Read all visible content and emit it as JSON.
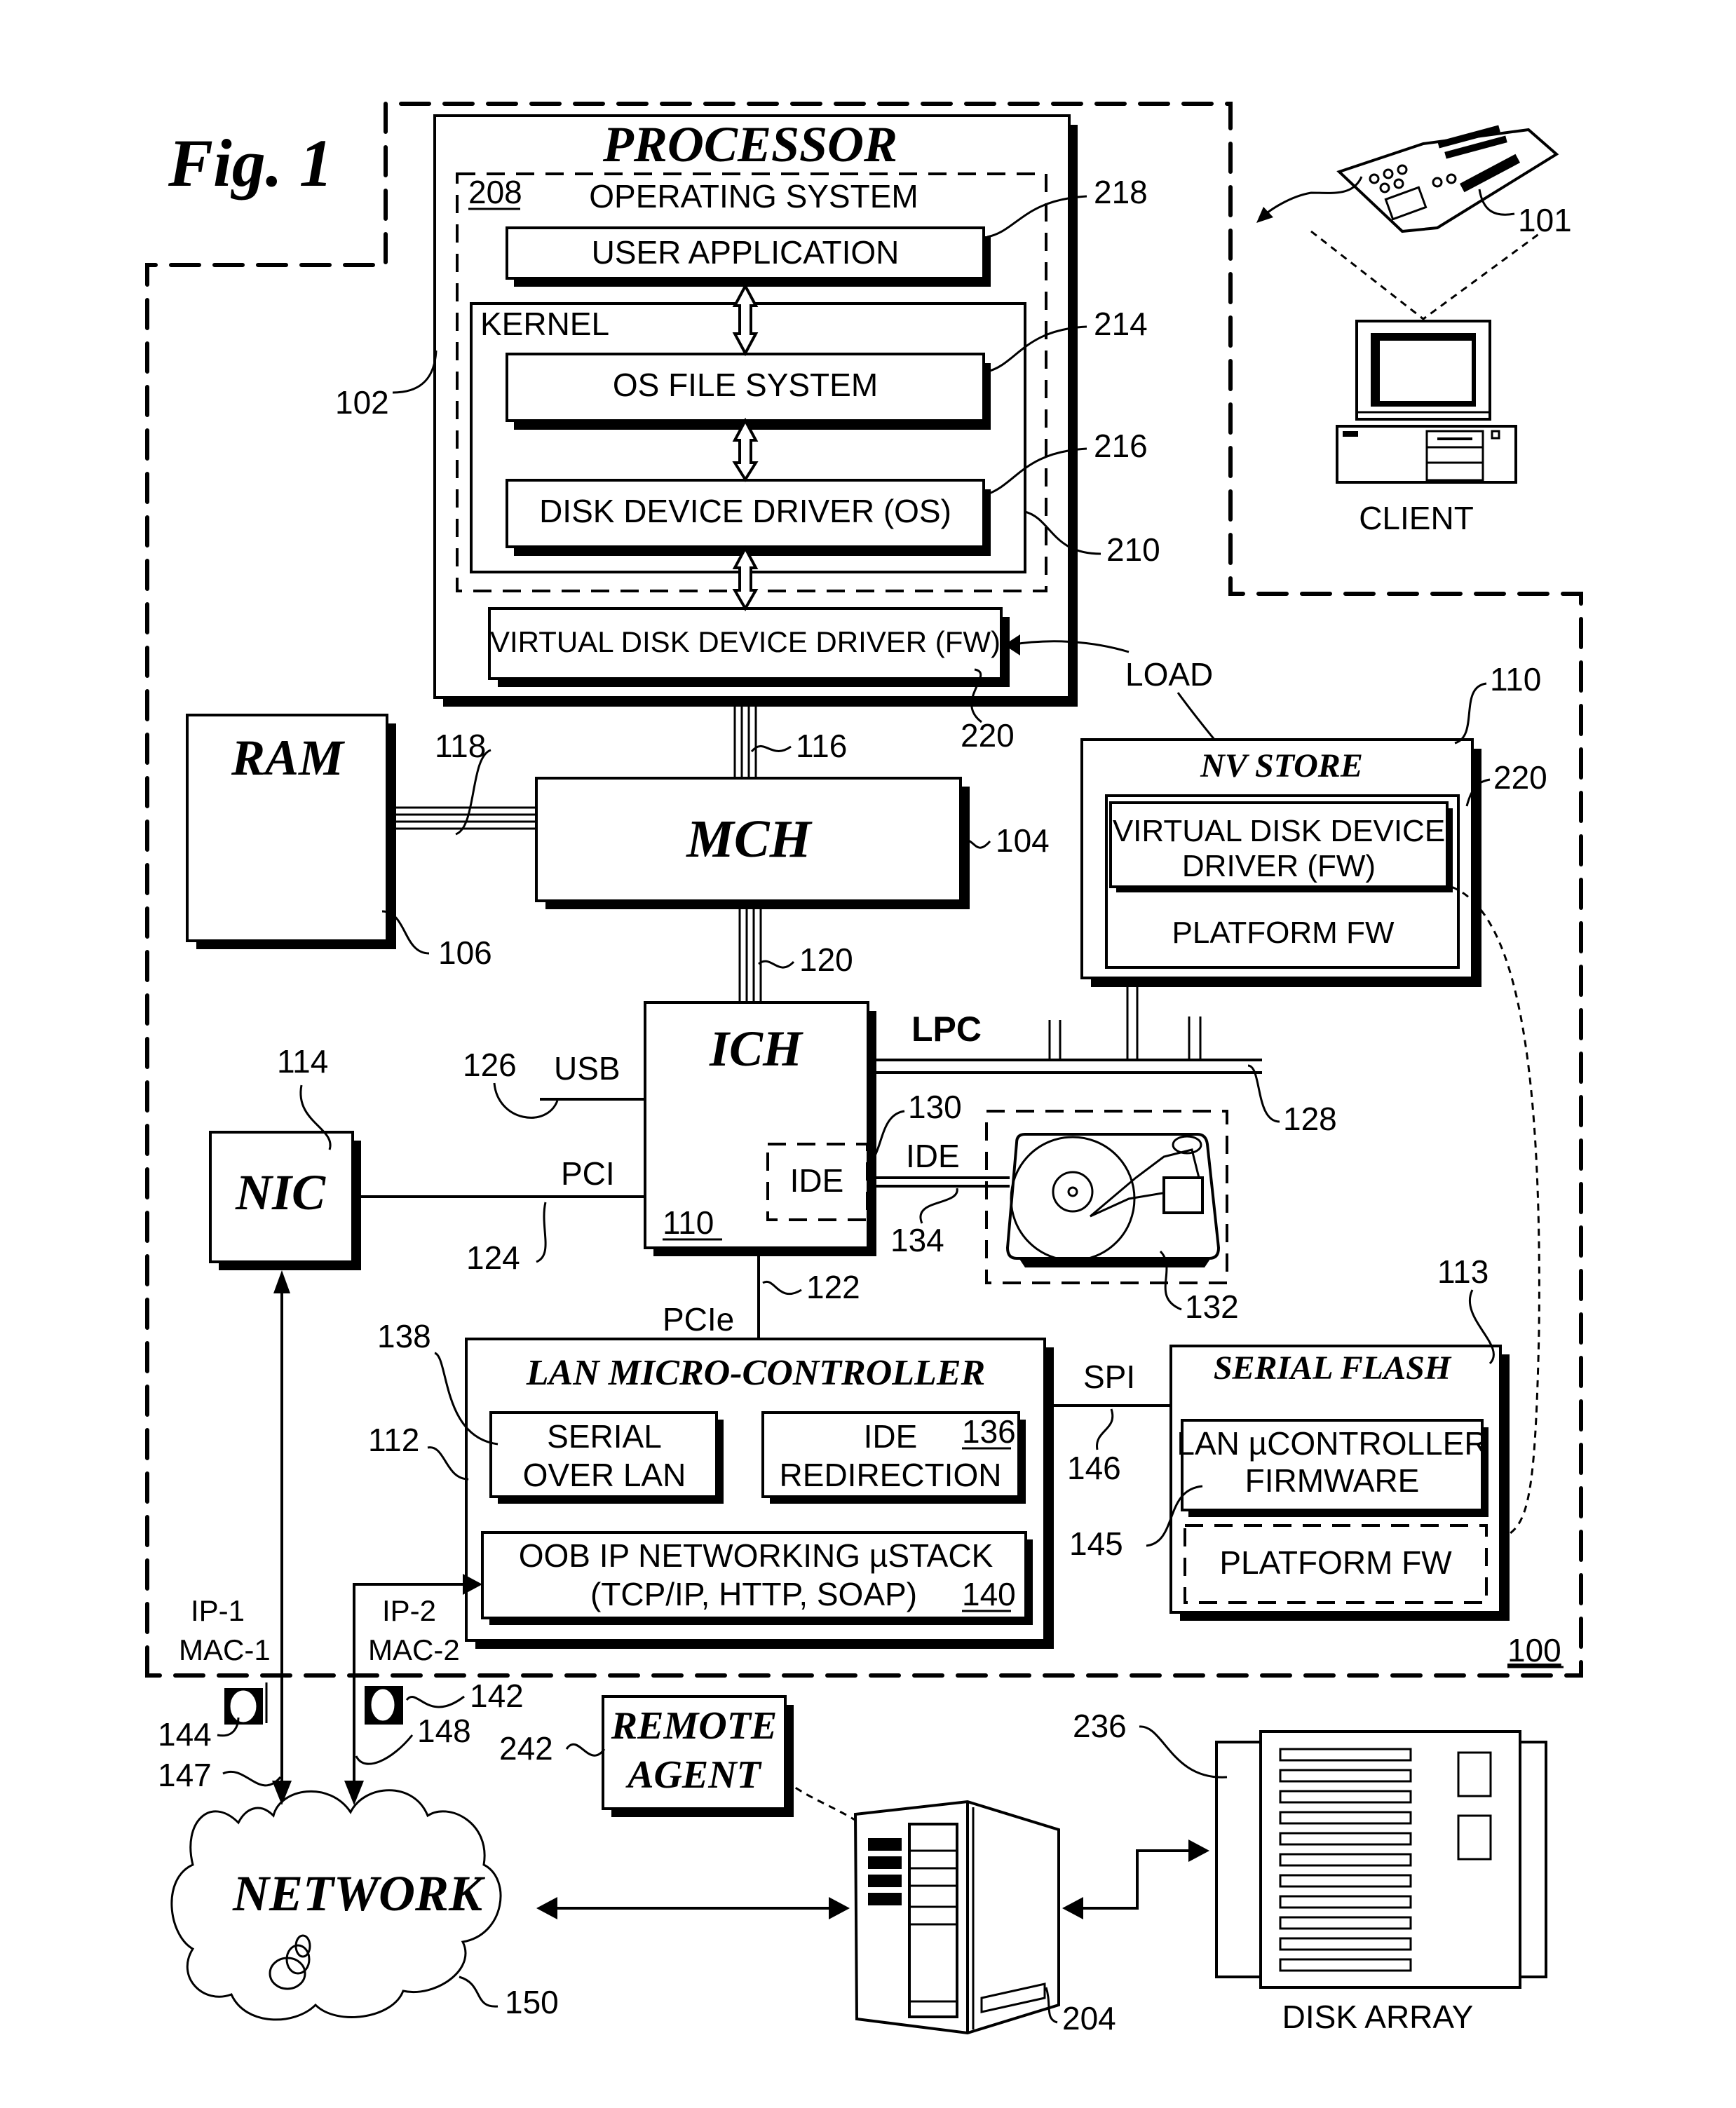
{
  "figure": {
    "title": "Fig. 1",
    "system_ref": "100"
  },
  "processor": {
    "title": "PROCESSOR",
    "ref": "102",
    "os": {
      "ref": "208",
      "label": "OPERATING SYSTEM"
    },
    "user_app": {
      "label": "USER APPLICATION",
      "ref": "218"
    },
    "kernel": {
      "label": "KERNEL",
      "ref": "210"
    },
    "os_fs": {
      "label": "OS FILE SYSTEM",
      "ref": "214"
    },
    "disk_driver": {
      "label": "DISK DEVICE DRIVER (OS)",
      "ref": "216"
    },
    "virtual_driver": {
      "label": "VIRTUAL DISK DEVICE DRIVER (FW)",
      "ref": "220"
    },
    "load_label": "LOAD"
  },
  "ram": {
    "label": "RAM",
    "ref": "106",
    "bus_ref": "118"
  },
  "mch": {
    "label": "MCH",
    "ref": "104",
    "bus_up_ref": "116",
    "bus_down_ref": "120"
  },
  "ich": {
    "label": "ICH",
    "ref": "110",
    "usb_label": "USB",
    "usb_ref": "126",
    "pci_label": "PCI",
    "pci_ref": "124",
    "lpc_label": "LPC",
    "lpc_ref": "128",
    "ide_inner": "IDE",
    "ide_inner_ref": "130",
    "ide_bus_label": "IDE",
    "ide_bus_ref": "134",
    "pcie_label": "PCIe",
    "pcie_ref": "122"
  },
  "nic": {
    "label": "NIC",
    "ref": "114"
  },
  "nv_store": {
    "title": "NV STORE",
    "ref": "110",
    "driver_line1": "VIRTUAL DISK DEVICE",
    "driver_line2": "DRIVER (FW)",
    "driver_ref": "220",
    "platform_fw": "PLATFORM FW"
  },
  "hdd": {
    "ref": "132"
  },
  "lan_controller": {
    "title": "LAN MICRO-CONTROLLER",
    "ref": "112",
    "sol_line1": "SERIAL",
    "sol_line2": "OVER LAN",
    "sol_ref": "138",
    "ider_line1": "IDE",
    "ider_line2": "REDIRECTION",
    "ider_ref": "136",
    "stack_line1": "OOB IP NETWORKING µSTACK",
    "stack_line2": "(TCP/IP, HTTP, SOAP)",
    "stack_ref": "140",
    "spi_label": "SPI",
    "spi_ref": "146"
  },
  "serial_flash": {
    "title": "SERIAL FLASH",
    "ref": "113",
    "fw_line1": "LAN µCONTROLLER",
    "fw_line2": "FIRMWARE",
    "fw_ref": "145",
    "platform_fw": "PLATFORM FW"
  },
  "ports": {
    "p1_ip": "IP-1",
    "p1_mac": "MAC-1",
    "p1_ref": "144",
    "p1_link_ref": "147",
    "p2_ip": "IP-2",
    "p2_mac": "MAC-2",
    "p2_ref": "142",
    "p2_link_ref": "148"
  },
  "network": {
    "label": "NETWORK",
    "ref": "150"
  },
  "remote_agent": {
    "line1": "REMOTE",
    "line2": "AGENT",
    "ref": "242"
  },
  "server": {
    "ref": "204"
  },
  "disk_array": {
    "label": "DISK ARRAY",
    "ref": "236"
  },
  "client": {
    "label": "CLIENT",
    "board_ref": "101"
  }
}
